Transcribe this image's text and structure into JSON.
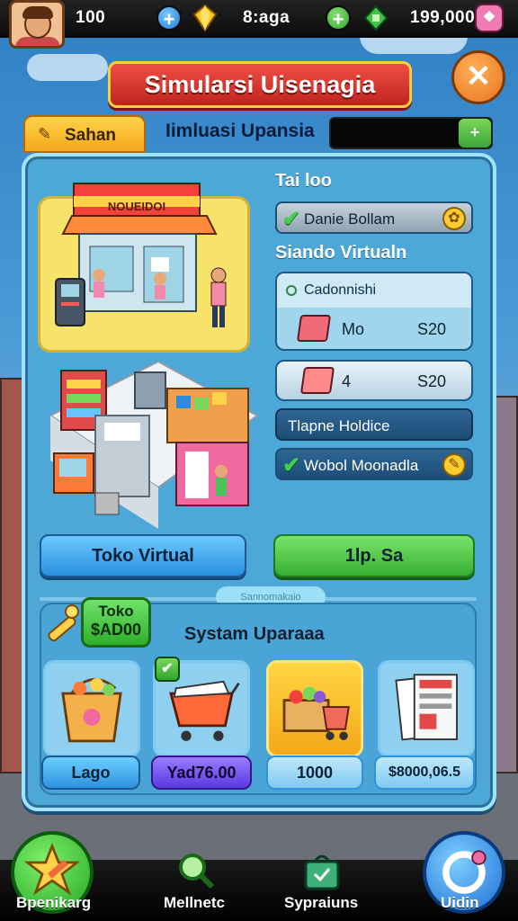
{
  "topbar": {
    "coins": "100",
    "gems": "8:aga",
    "cash": "199,000"
  },
  "header": {
    "title": "Simularsi Uisenagia",
    "close_icon": "close-icon"
  },
  "tabs": {
    "active_label": "Sahan",
    "subtitle": "Iimluasi Upansia"
  },
  "right_panel": {
    "heading1": "Tai loo",
    "pill1": "Danie Bollam",
    "heading2": "Siando Virtualn",
    "list_header": "Cadonnishi",
    "item1": {
      "name": "Mo",
      "price": "S20"
    },
    "item2": {
      "name": "4",
      "price": "S20"
    },
    "navy_bar": "Tlapne Holdice",
    "pill2": "Wobol Moonadla"
  },
  "buttons": {
    "left": "Toko Virtual",
    "right": "1lp. Sa"
  },
  "lower": {
    "divider_tag": "Sannomakaio",
    "toko_label": "Toko",
    "toko_value": "$AD00",
    "heading": "Systam Uparaaa",
    "cards": [
      {
        "label": "Lago",
        "icon": "basket-icon"
      },
      {
        "label": "Yad76.00",
        "icon": "shopping-cart-icon"
      },
      {
        "label": "1000",
        "icon": "groceries-box-icon"
      },
      {
        "label": "$8000,06.5",
        "icon": "catalog-icon"
      }
    ]
  },
  "bottom_nav": [
    {
      "label": "Bpenikarg",
      "icon": "star-pencil-icon"
    },
    {
      "label": "Mellnetc",
      "icon": "magnifier-icon"
    },
    {
      "label": "Sypraiuns",
      "icon": "shop-bag-icon"
    },
    {
      "label": "Uidin",
      "icon": "refresh-icon"
    }
  ],
  "colors": {
    "accent_red": "#d8352d",
    "accent_green": "#36b033",
    "accent_blue": "#2a8fe0",
    "panel": "#4da8d8",
    "gold": "#f4a81a"
  }
}
